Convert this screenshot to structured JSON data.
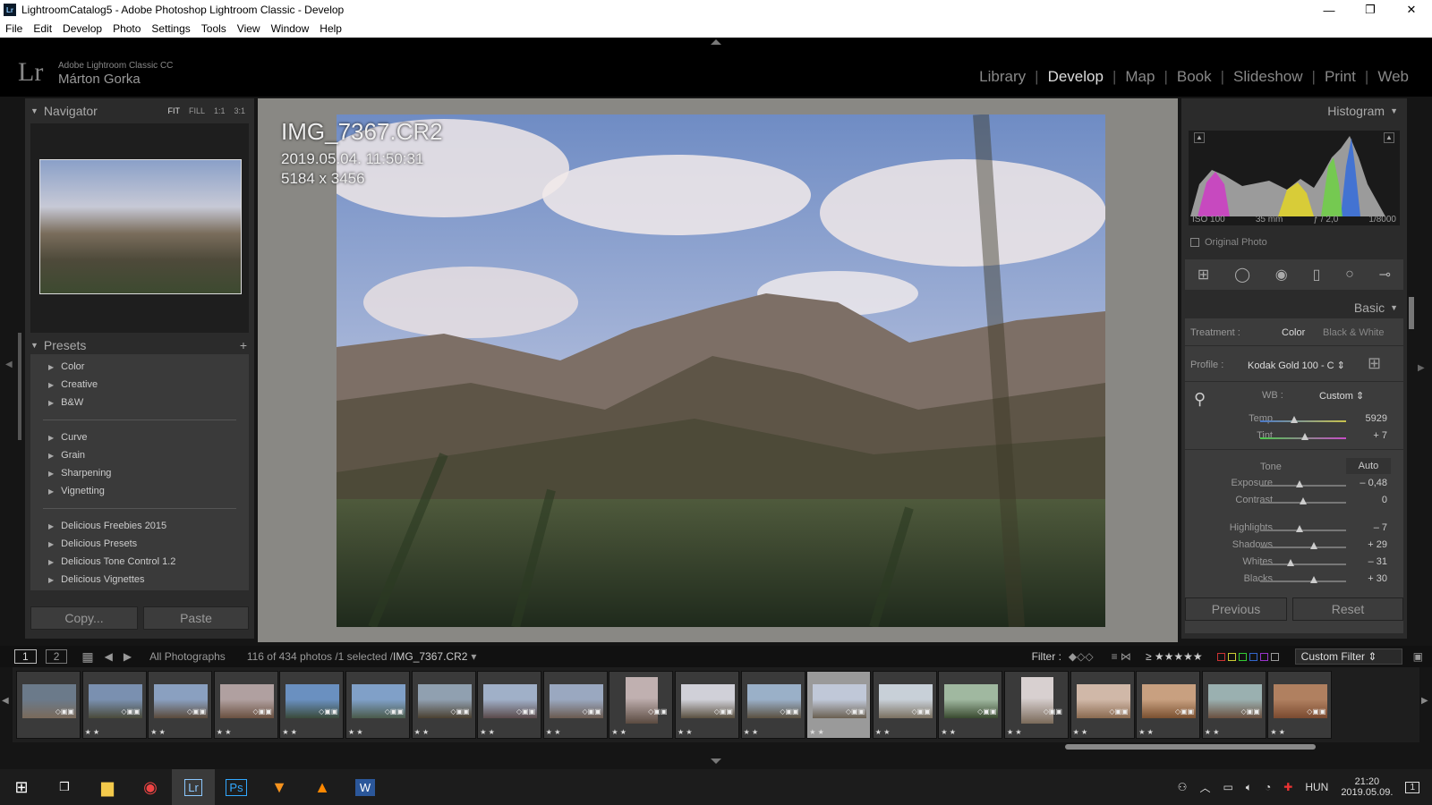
{
  "window": {
    "title": "LightroomCatalog5 - Adobe Photoshop Lightroom Classic - Develop",
    "app_icon": "Lr"
  },
  "menu": [
    "File",
    "Edit",
    "Develop",
    "Photo",
    "Settings",
    "Tools",
    "View",
    "Window",
    "Help"
  ],
  "identity": {
    "logo": "Lr",
    "product": "Adobe Lightroom Classic CC",
    "user": "Márton Gorka"
  },
  "modules": [
    {
      "label": "Library"
    },
    {
      "label": "Develop",
      "active": true
    },
    {
      "label": "Map"
    },
    {
      "label": "Book"
    },
    {
      "label": "Slideshow"
    },
    {
      "label": "Print"
    },
    {
      "label": "Web"
    }
  ],
  "navigator": {
    "title": "Navigator",
    "zoom": [
      "FIT",
      "FILL",
      "1:1",
      "3:1"
    ]
  },
  "presets": {
    "title": "Presets",
    "groups": [
      [
        "Color",
        "Creative",
        "B&W"
      ],
      [
        "Curve",
        "Grain",
        "Sharpening",
        "Vignetting"
      ],
      [
        "Delicious Freebies 2015",
        "Delicious Presets",
        "Delicious Tone Control 1.2",
        "Delicious Vignettes"
      ]
    ]
  },
  "left_buttons": {
    "copy": "Copy...",
    "paste": "Paste"
  },
  "photo_info": {
    "filename": "IMG_7367.CR2",
    "datetime": "2019.05.04. 11:50:31",
    "dimensions": "5184 x 3456"
  },
  "histogram": {
    "title": "Histogram",
    "iso": "ISO 100",
    "focal": "35 mm",
    "aperture": "ƒ / 2,0",
    "shutter": "1/8000",
    "original_photo": "Original Photo"
  },
  "basic": {
    "title": "Basic",
    "treatment_label": "Treatment :",
    "treatment_color": "Color",
    "treatment_bw": "Black & White",
    "profile_label": "Profile :",
    "profile_value": "Kodak Gold 100 - C",
    "wb_label": "WB :",
    "wb_value": "Custom",
    "tone_label": "Tone",
    "auto_label": "Auto",
    "sliders": [
      {
        "name": "temp",
        "label": "Temp",
        "value": "5929",
        "pos": 0.4
      },
      {
        "name": "tint",
        "label": "Tint",
        "value": "+ 7",
        "pos": 0.52
      },
      {
        "name": "exposure",
        "label": "Exposure",
        "value": "– 0,48",
        "pos": 0.46
      },
      {
        "name": "contrast",
        "label": "Contrast",
        "value": "0",
        "pos": 0.5
      },
      {
        "name": "highlights",
        "label": "Highlights",
        "value": "– 7",
        "pos": 0.46
      },
      {
        "name": "shadows",
        "label": "Shadows",
        "value": "+ 29",
        "pos": 0.62
      },
      {
        "name": "whites",
        "label": "Whites",
        "value": "– 31",
        "pos": 0.35
      },
      {
        "name": "blacks",
        "label": "Blacks",
        "value": "+ 30",
        "pos": 0.63
      }
    ]
  },
  "right_buttons": {
    "previous": "Previous",
    "reset": "Reset"
  },
  "filmbar": {
    "page1": "1",
    "page2": "2",
    "source": "All Photographs",
    "count": "116 of 434 photos /1 selected /",
    "current": "IMG_7367.CR2",
    "filter_label": "Filter :",
    "custom_filter": "Custom Filter",
    "stars_filter": "≥ ★★★★★"
  },
  "filmstrip": {
    "thumbs": 20,
    "selected_index": 12,
    "stars": "★ ★"
  },
  "taskbar": {
    "lang": "HUN",
    "time": "21:20",
    "date": "2019.05.09.",
    "notif": "1"
  }
}
